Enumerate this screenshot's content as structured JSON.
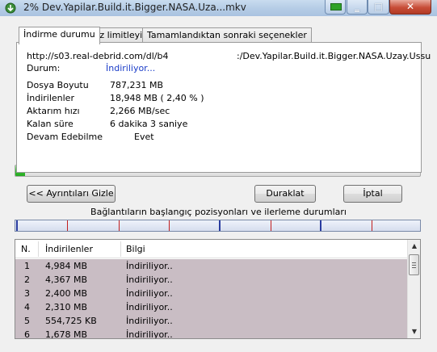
{
  "window": {
    "title": "2% Dev.Yapilar.Build.it.Bigger.NASA.Uza...mkv",
    "icons": {
      "app": "download-app-icon",
      "minimize": "minimize-icon",
      "maximize": "maximize-icon",
      "close": "close-icon",
      "extra": "green-window-icon"
    },
    "colors": {
      "title_bar": "#b6cde6",
      "close_button": "#c74d37"
    }
  },
  "tabs": [
    {
      "label": "İndirme durumu",
      "active": true
    },
    {
      "label": "Hız limitleyici",
      "active": false
    },
    {
      "label": "Tamamlandıktan sonraki seçenekler",
      "active": false
    }
  ],
  "details": {
    "url_start": "http://s03.real-debrid.com/dl/b4",
    "url_end": ":/Dev.Yapilar.Build.it.Bigger.NASA.Uzay.Ussu",
    "status_label": "Durum:",
    "status_value": "İndiriliyor...",
    "status_color": "#1a3cc8",
    "rows": [
      {
        "label": "Dosya Boyutu",
        "value": "787,231  MB"
      },
      {
        "label": "İndirilenler",
        "value": "18,948  MB  ( 2,40 % )"
      },
      {
        "label": "Aktarım hızı",
        "value": "2,266  MB/sec"
      },
      {
        "label": "Kalan süre",
        "value": "6 dakika 3 saniye"
      },
      {
        "label": "Devam Edebilme",
        "value": "Evet"
      }
    ]
  },
  "progress": {
    "percent": 2.4,
    "color": "#36c42f"
  },
  "buttons": {
    "details": "<< Ayrıntıları Gizle",
    "pause": "Duraklat",
    "cancel": "İptal"
  },
  "connections": {
    "label": "Bağlantıların başlangıç pozisyonları ve ilerleme durumları",
    "marker_color": "#c21e1e"
  },
  "list": {
    "columns": [
      "N.",
      "İndirilenler",
      "Bilgi"
    ],
    "rows": [
      {
        "n": "1",
        "downloaded": "4,984  MB",
        "info": "İndiriliyor.."
      },
      {
        "n": "2",
        "downloaded": "4,367  MB",
        "info": "İndiriliyor.."
      },
      {
        "n": "3",
        "downloaded": "2,400  MB",
        "info": "İndiriliyor.."
      },
      {
        "n": "4",
        "downloaded": "2,310  MB",
        "info": "İndiriliyor.."
      },
      {
        "n": "5",
        "downloaded": "554,725  KB",
        "info": "İndiriliyor.."
      },
      {
        "n": "6",
        "downloaded": "1,678  MB",
        "info": "İndiriliyor.."
      }
    ],
    "row_color": "#c9bdc4",
    "scroll_up_icon": "scroll-up-arrow-icon",
    "scroll_down_icon": "scroll-down-arrow-icon"
  }
}
